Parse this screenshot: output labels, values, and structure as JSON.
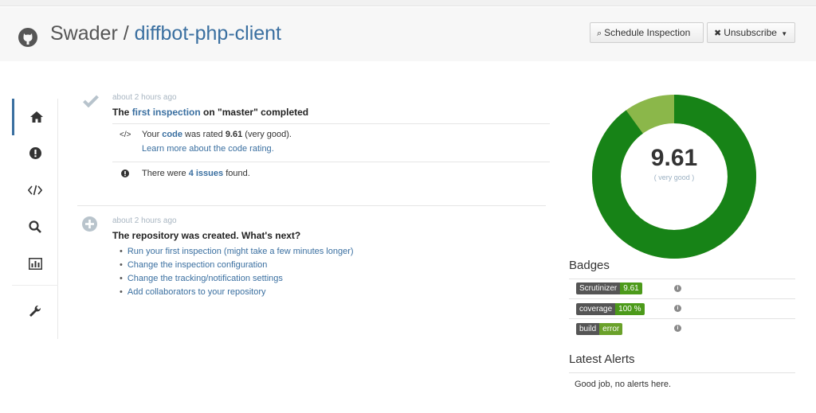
{
  "header": {
    "owner": "Swader",
    "separator": "/",
    "repo": "diffbot-php-client",
    "schedule_label": "Schedule Inspection",
    "unsubscribe_label": "Unsubscribe"
  },
  "sidenav": [
    "home-icon",
    "issues-icon",
    "code-icon",
    "search-icon",
    "statistics-icon",
    "settings-icon"
  ],
  "events": [
    {
      "time": "about 2 hours ago",
      "title_pre": "The",
      "title_link": "first inspection",
      "title_post": "on \"master\" completed",
      "rating": {
        "pre": "Your",
        "link": "code",
        "mid": "was rated",
        "value": "9.61",
        "post": "(very good).",
        "learn_pre": "Learn more about",
        "learn_link": "the code rating",
        "learn_post": "."
      },
      "issues": {
        "pre": "There were",
        "link": "4 issues",
        "post": "found."
      }
    },
    {
      "time": "about 2 hours ago",
      "title": "The repository was created. What's next?",
      "todos": [
        "Run your first inspection (might take a few minutes longer)",
        "Change the inspection configuration",
        "Change the tracking/notification settings",
        "Add collaborators to your repository"
      ]
    }
  ],
  "score": {
    "value": "9.61",
    "label": "( very good )",
    "fraction": 0.9,
    "main_color": "#178317",
    "rest_color": "#8bb74a"
  },
  "badges": {
    "heading": "Badges",
    "items": [
      {
        "label": "Scrutinizer",
        "value": "9.61",
        "color": "#4c9a1a"
      },
      {
        "label": "coverage",
        "value": "100 %",
        "color": "#4c9a1a"
      },
      {
        "label": "build",
        "value": "error",
        "color": "#6aa12a"
      }
    ]
  },
  "alerts": {
    "heading": "Latest Alerts",
    "text": "Good job, no alerts here."
  }
}
